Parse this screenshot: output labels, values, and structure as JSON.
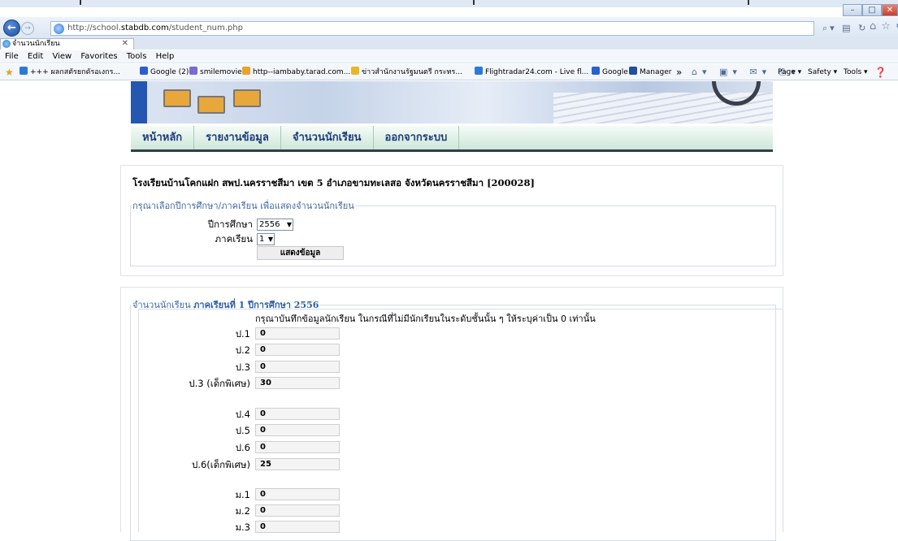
{
  "browser": {
    "url_prefix": "http://school.",
    "url_host": "stabdb.com",
    "url_path": "/student_num.php",
    "tab_title": "จำนวนนักเรียน",
    "menu": [
      "File",
      "Edit",
      "View",
      "Favorites",
      "Tools",
      "Help"
    ],
    "favorites": [
      {
        "label": "+++ ผลกสตัรยกดัรอเงกร...",
        "color": "#2a7ad6"
      },
      {
        "label": "Google (2)",
        "color": "#2a5fd0"
      },
      {
        "label": "smilemovie",
        "color": "#7a6bd1"
      },
      {
        "label": "http--iambaby.tarad.com...",
        "color": "#e9a32a"
      },
      {
        "label": "ข่าวสำนักงานรัฐมนตรี กระทร...",
        "color": "#e8b727"
      },
      {
        "label": "Flightradar24.com - Live fl...",
        "color": "#2a7ad6"
      },
      {
        "label": "Google",
        "color": "#2a5fd0"
      },
      {
        "label": "Manager",
        "color": "#1f4f9d"
      }
    ],
    "command_bar": [
      "Page ▾",
      "Safety ▾",
      "Tools ▾"
    ]
  },
  "nav": {
    "items": [
      "หน้าหลัก",
      "รายงานข้อมูล",
      "จำนวนนักเรียน",
      "ออกจากระบบ"
    ]
  },
  "school": {
    "name": "โรงเรียนบ้านโคกแฝก สพป.นครราชสีมา เขต 5 อำเภอขามทะเลสอ จังหวัดนครราชสีมา [200028]"
  },
  "selector": {
    "legend": "กรุณาเลือกปีการศึกษา/ภาคเรียน เพื่อแสดงจำนวนนักเรียน",
    "year_label": "ปีการศึกษา",
    "year_value": "2556",
    "term_label": "ภาคเรียน",
    "term_value": "1",
    "show_button": "แสดงข้อมูล"
  },
  "students": {
    "legend_prefix": "จำนวนนักเรียน",
    "legend_bold": "ภาคเรียนที่ 1 ปีการศึกษา 2556",
    "note": "กรุณาบันทึกข้อมูลนักเรียน ในกรณีที่ไม่มีนักเรียนในระดับชั้นนั้น ๆ ให้ระบุค่าเป็น 0 เท่านั้น",
    "rows": [
      {
        "label": "ป.1",
        "value": "0"
      },
      {
        "label": "ป.2",
        "value": "0"
      },
      {
        "label": "ป.3",
        "value": "0"
      },
      {
        "label": "ป.3 (เด็กพิเศษ)",
        "value": "30"
      },
      {
        "label": "ป.4",
        "value": "0"
      },
      {
        "label": "ป.5",
        "value": "0"
      },
      {
        "label": "ป.6",
        "value": "0"
      },
      {
        "label": "ป.6(เด็กพิเศษ)",
        "value": "25"
      },
      {
        "label": "ม.1",
        "value": "0"
      },
      {
        "label": "ม.2",
        "value": "0"
      },
      {
        "label": "ม.3",
        "value": "0"
      }
    ]
  }
}
